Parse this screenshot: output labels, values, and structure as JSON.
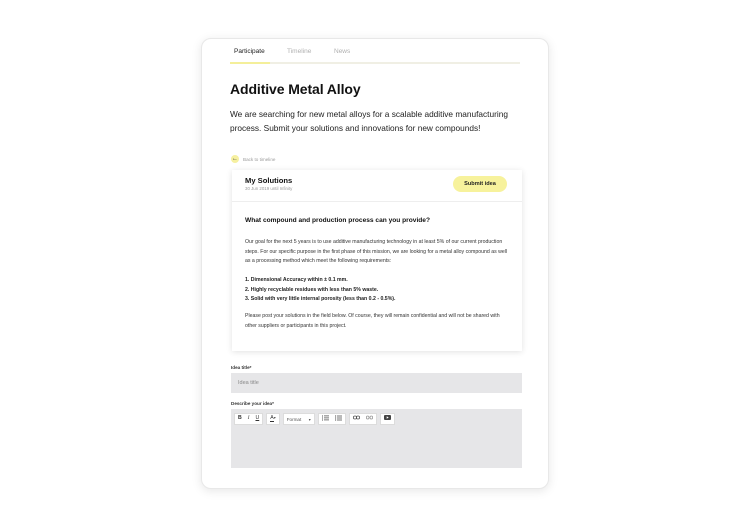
{
  "tabs": [
    {
      "label": "Participate",
      "active": true
    },
    {
      "label": "Timeline",
      "active": false
    },
    {
      "label": "News",
      "active": false
    }
  ],
  "page": {
    "title": "Additive Metal Alloy",
    "intro": "We are searching for new metal alloys for a scalable additive manufacturing process. Submit your solutions and innovations for new compounds!"
  },
  "back": {
    "label": "Back to timeline",
    "icon": "arrow-left-icon"
  },
  "card": {
    "title": "My Solutions",
    "date": "30 Jun 2019 until Infinity",
    "submit_label": "Submit idea",
    "question": "What compound and production process can you provide?",
    "paragraph1": "Our goal for the next 5 years is to use additive manufacturing technology in at least 5% of our current production steps. For our specific purpose in the first phase of this mission, we are looking for a metal alloy compound as well as a processing method which meet the following requirements:",
    "requirements": [
      "1. Dimensional Accuracy within ± 0.1 mm.",
      "2. Highly recyclable residues with less than 5% waste.",
      "3. Solid with very little internal porosity (less than 0.2 - 0.5%)."
    ],
    "paragraph2": "Please post your solutions in the field below. Of course, they will remain confidential and will not be shared with other suppliers or participants in this project."
  },
  "form": {
    "idea_title_label": "Idea title*",
    "idea_title_placeholder": "Idea title",
    "describe_label": "Describe your idea*",
    "toolbar": {
      "bold": "B",
      "italic": "I",
      "underline": "U",
      "font_color": "A",
      "format_label": "Format",
      "caret": "▾"
    }
  },
  "colors": {
    "accent": "#f7f29c",
    "field_bg": "#e6e6e8"
  }
}
